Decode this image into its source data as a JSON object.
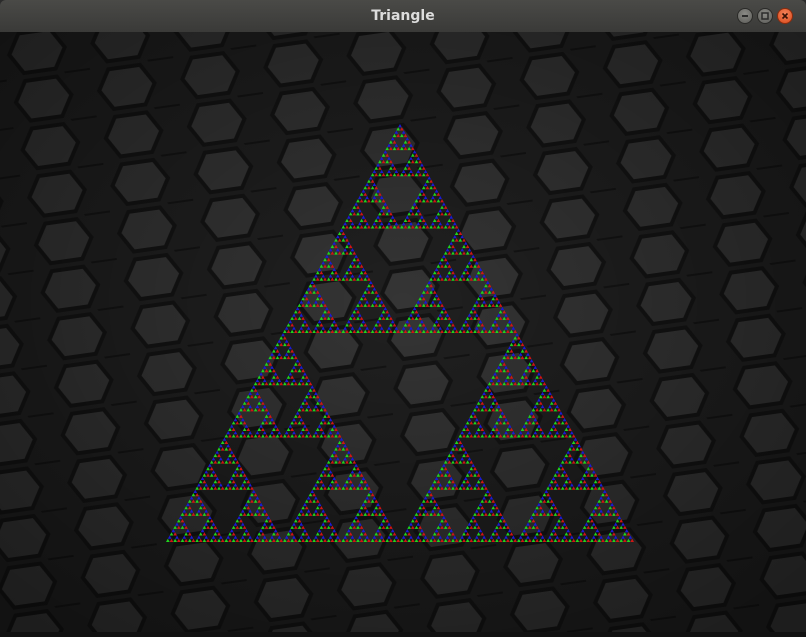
{
  "window": {
    "title": "Triangle"
  },
  "controls": {
    "minimize_icon": "minimize-icon",
    "maximize_icon": "maximize-icon",
    "close_icon": "close-icon"
  },
  "fractal": {
    "shape": "sierpinski-triangle",
    "colors": {
      "top": "#1a1ad6",
      "left": "#1fd41f",
      "right": "#d01515"
    }
  },
  "background": {
    "pattern": "dark-hexagon-texture",
    "base_color": "#242424",
    "cell_color": "#333333"
  }
}
